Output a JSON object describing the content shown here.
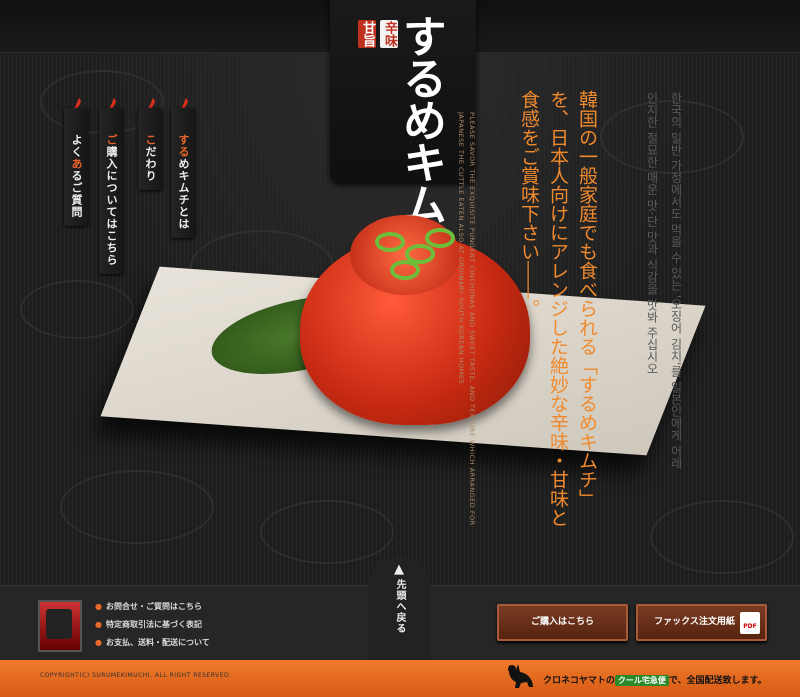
{
  "logo": {
    "tag_sweet": "甘旨",
    "tag_spicy": "辛味",
    "title": "するめキムチ"
  },
  "nav": {
    "items": [
      {
        "pre": "",
        "hl": "する",
        "post": "めキムチとは"
      },
      {
        "pre": "",
        "hl": "こ",
        "post": "だわり"
      },
      {
        "pre": "",
        "hl": "ご",
        "post": "購入についてはこちら"
      },
      {
        "pre": "よく",
        "hl": "あ",
        "post": "るご質問"
      }
    ]
  },
  "hero": {
    "tagline": "韓国の一般家庭でも食べられる「するめキムチ」を、日本人向けにアレンジした絶妙な辛味・甘味と食感をご賞味下さい――。",
    "subcopy": "PLEASE SAVOR THE EXQUISITE PUNGENT CINCHONAS AND SWEET TASTE, AND TEXTURE WHICH ARRANGED FOR JAPANESE THE CUTTLE EATEN ALSO AT ORDINARY SOUTH KOREAN HOMES.",
    "korean": "한국의 일반 가정에서도 먹을 수 있는 '오징어 김치'를 일본인에게 어레인지한 절묘한 매운 맛·단 맛과 식감을 맛봐 주십시오"
  },
  "back_to_top": {
    "arrow": "▲",
    "label": "先頭へ戻る"
  },
  "footer": {
    "links": [
      "お問合せ・ご質問はこちら",
      "特定商取引法に基づく表記",
      "お支払、送料・配送について"
    ],
    "buy_button": "ご購入はこちら",
    "fax_button": "ファックス注文用紙",
    "pdf_label": "PDF",
    "copyright": "COPYRIGHT(C) SURUMEKIMUCHI. ALL RIGHT RESERVED.",
    "shipping_pre": "クロネコヤマトの",
    "shipping_badge": "クール宅急便",
    "shipping_post": "で、全国配送致します。"
  },
  "colors": {
    "accent": "#e8632a",
    "tagline": "#f08a2e",
    "bottom_bar": "#f07a2a"
  }
}
